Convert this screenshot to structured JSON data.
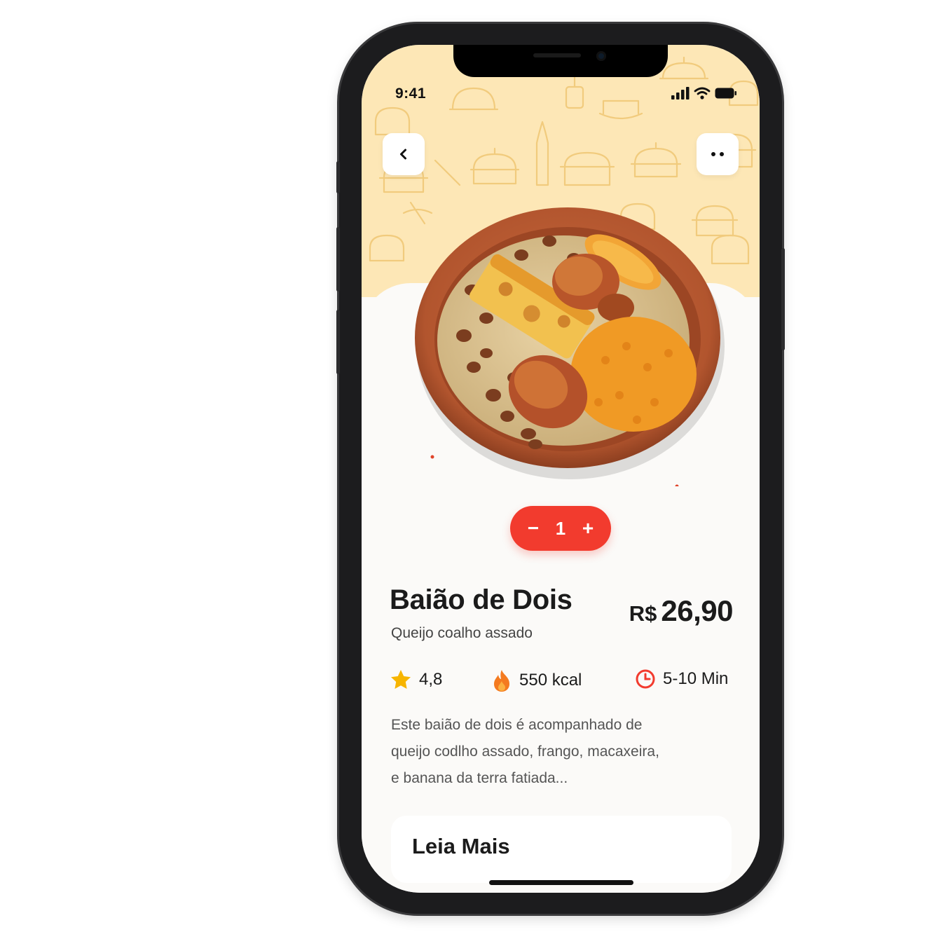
{
  "status_bar": {
    "time": "9:41"
  },
  "header": {
    "back_icon": "chevron-left-icon",
    "more_icon": "more-dots-icon"
  },
  "product": {
    "name": "Baião de Dois",
    "subtitle": "Queijo coalho assado",
    "currency": "R$",
    "price": "26,90",
    "quantity": "1",
    "decrement_label": "−",
    "increment_label": "+"
  },
  "stats": {
    "rating": "4,8",
    "calories": "550 kcal",
    "time": "5-10 Min"
  },
  "description": {
    "line1": "Este baião de dois é acompanhado de",
    "line2": "queijo codlho assado, frango, macaxeira,",
    "line3": "e banana da terra fatiada..."
  },
  "read_more_label": "Leia Mais",
  "colors": {
    "accent": "#f23b2e",
    "hero_bg": "#fde7b6",
    "star": "#f7b500",
    "flame": "#f47a1f"
  }
}
